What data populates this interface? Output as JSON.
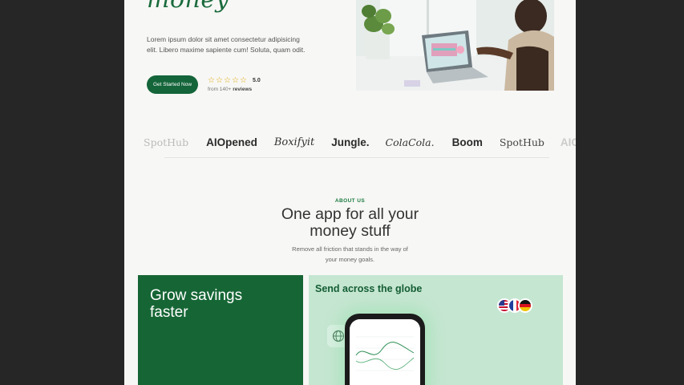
{
  "hero": {
    "headline_word": "money",
    "description": "Lorem ipsum dolor sit amet consectetur adipisicing elit. Libero maxime sapiente cum! Soluta, quam odit.",
    "cta_label": "Get Started Now",
    "rating_value": "5.0",
    "reviews_prefix": "from 140+ ",
    "reviews_suffix": "reviews",
    "star_count": 5
  },
  "logos": [
    "SpotHub",
    "AIOpened",
    "Boxifyit",
    "Jungle.",
    "ColaCola.",
    "Boom",
    "SpotHub",
    "AIOpened"
  ],
  "about": {
    "eyebrow": "ABOUT US",
    "headline_line1": "One app for all your",
    "headline_line2": "money stuff",
    "sub_line1": "Remove all friction that stands in the way of",
    "sub_line2": "your money goals."
  },
  "cards": {
    "savings_line1": "Grow savings",
    "savings_line2": "faster",
    "global_title": "Send across the globe",
    "flags": [
      "us-flag-icon",
      "france-flag-icon",
      "germany-flag-icon"
    ]
  },
  "colors": {
    "brand_green": "#14653a",
    "mint": "#c5e6d1",
    "page_bg": "#f7f7f5",
    "outer_bg": "#262626"
  }
}
